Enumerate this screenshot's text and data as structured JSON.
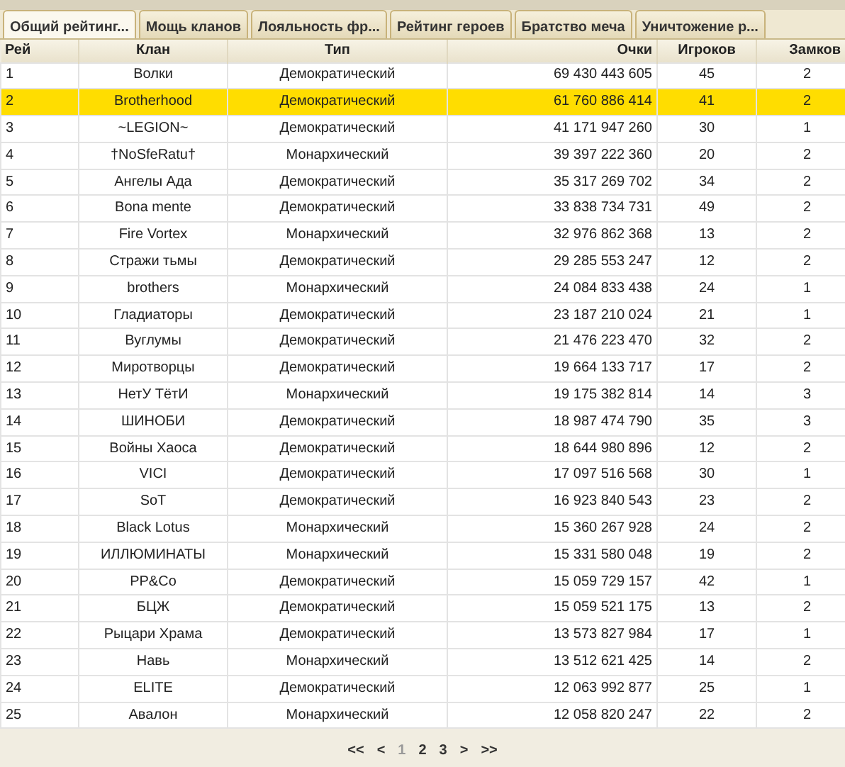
{
  "tabs": [
    {
      "label": "Общий рейтинг...",
      "selected": true
    },
    {
      "label": "Мощь кланов",
      "selected": false
    },
    {
      "label": "Лояльность фр...",
      "selected": false
    },
    {
      "label": "Рейтинг героев",
      "selected": false
    },
    {
      "label": "Братство меча",
      "selected": false
    },
    {
      "label": "Уничтожение р...",
      "selected": false
    }
  ],
  "table": {
    "columns": [
      "Рей",
      "Клан",
      "Тип",
      "Очки",
      "Игроков",
      "Замков"
    ],
    "rows": [
      {
        "cells": [
          "1",
          "Волки",
          "Демократический",
          "69 430 443 605",
          "45",
          "2"
        ],
        "selected": false
      },
      {
        "cells": [
          "2",
          "Brotherhood",
          "Демократический",
          "61 760 886 414",
          "41",
          "2"
        ],
        "selected": true
      },
      {
        "cells": [
          "3",
          "~LEGION~",
          "Демократический",
          "41 171 947 260",
          "30",
          "1"
        ],
        "selected": false
      },
      {
        "cells": [
          "4",
          "†NoSfeRatu†",
          "Монархический",
          "39 397 222 360",
          "20",
          "2"
        ],
        "selected": false
      },
      {
        "cells": [
          "5",
          "Ангелы Ада",
          "Демократический",
          "35 317 269 702",
          "34",
          "2"
        ],
        "selected": false
      },
      {
        "cells": [
          "6",
          "Bona mente",
          "Демократический",
          "33 838 734 731",
          "49",
          "2"
        ],
        "selected": false
      },
      {
        "cells": [
          "7",
          "Fire Vortex",
          "Монархический",
          "32 976 862 368",
          "13",
          "2"
        ],
        "selected": false
      },
      {
        "cells": [
          "8",
          "Стражи тьмы",
          "Демократический",
          "29 285 553 247",
          "12",
          "2"
        ],
        "selected": false
      },
      {
        "cells": [
          "9",
          "brothers",
          "Монархический",
          "24 084 833 438",
          "24",
          "1"
        ],
        "selected": false
      },
      {
        "cells": [
          "10",
          "Гладиаторы",
          "Демократический",
          "23 187 210 024",
          "21",
          "1"
        ],
        "selected": false
      },
      {
        "cells": [
          "11",
          "Вуглумы",
          "Демократический",
          "21 476 223 470",
          "32",
          "2"
        ],
        "selected": false
      },
      {
        "cells": [
          "12",
          "Миротворцы",
          "Демократический",
          "19 664 133 717",
          "17",
          "2"
        ],
        "selected": false
      },
      {
        "cells": [
          "13",
          "НетУ ТётИ",
          "Монархический",
          "19 175 382 814",
          "14",
          "3"
        ],
        "selected": false
      },
      {
        "cells": [
          "14",
          "ШИНОБИ",
          "Демократический",
          "18 987 474 790",
          "35",
          "3"
        ],
        "selected": false
      },
      {
        "cells": [
          "15",
          "Войны Хаоса",
          "Демократический",
          "18 644 980 896",
          "12",
          "2"
        ],
        "selected": false
      },
      {
        "cells": [
          "16",
          "VICI",
          "Демократический",
          "17 097 516 568",
          "30",
          "1"
        ],
        "selected": false
      },
      {
        "cells": [
          "17",
          "SoT",
          "Демократический",
          "16 923 840 543",
          "23",
          "2"
        ],
        "selected": false
      },
      {
        "cells": [
          "18",
          "Black Lotus",
          "Монархический",
          "15 360 267 928",
          "24",
          "2"
        ],
        "selected": false
      },
      {
        "cells": [
          "19",
          "ИЛЛЮМИНАТЫ",
          "Монархический",
          "15 331 580 048",
          "19",
          "2"
        ],
        "selected": false
      },
      {
        "cells": [
          "20",
          "PP&Co",
          "Демократический",
          "15 059 729 157",
          "42",
          "1"
        ],
        "selected": false
      },
      {
        "cells": [
          "21",
          "БЦЖ",
          "Демократический",
          "15 059 521 175",
          "13",
          "2"
        ],
        "selected": false
      },
      {
        "cells": [
          "22",
          "Рыцари Храма",
          "Демократический",
          "13 573 827 984",
          "17",
          "1"
        ],
        "selected": false
      },
      {
        "cells": [
          "23",
          "Навь",
          "Монархический",
          "13 512 621 425",
          "14",
          "2"
        ],
        "selected": false
      },
      {
        "cells": [
          "24",
          "ELITE",
          "Демократический",
          "12 063 992 877",
          "25",
          "1"
        ],
        "selected": false
      },
      {
        "cells": [
          "25",
          "Авалон",
          "Монархический",
          "12 058 820 247",
          "22",
          "2"
        ],
        "selected": false
      }
    ]
  },
  "pagination": [
    {
      "label": "<<",
      "selected": false
    },
    {
      "label": "<",
      "selected": false
    },
    {
      "label": "1",
      "selected": true
    },
    {
      "label": "2",
      "selected": false
    },
    {
      "label": "3",
      "selected": false
    },
    {
      "label": ">",
      "selected": false
    },
    {
      "label": ">>",
      "selected": false
    }
  ]
}
